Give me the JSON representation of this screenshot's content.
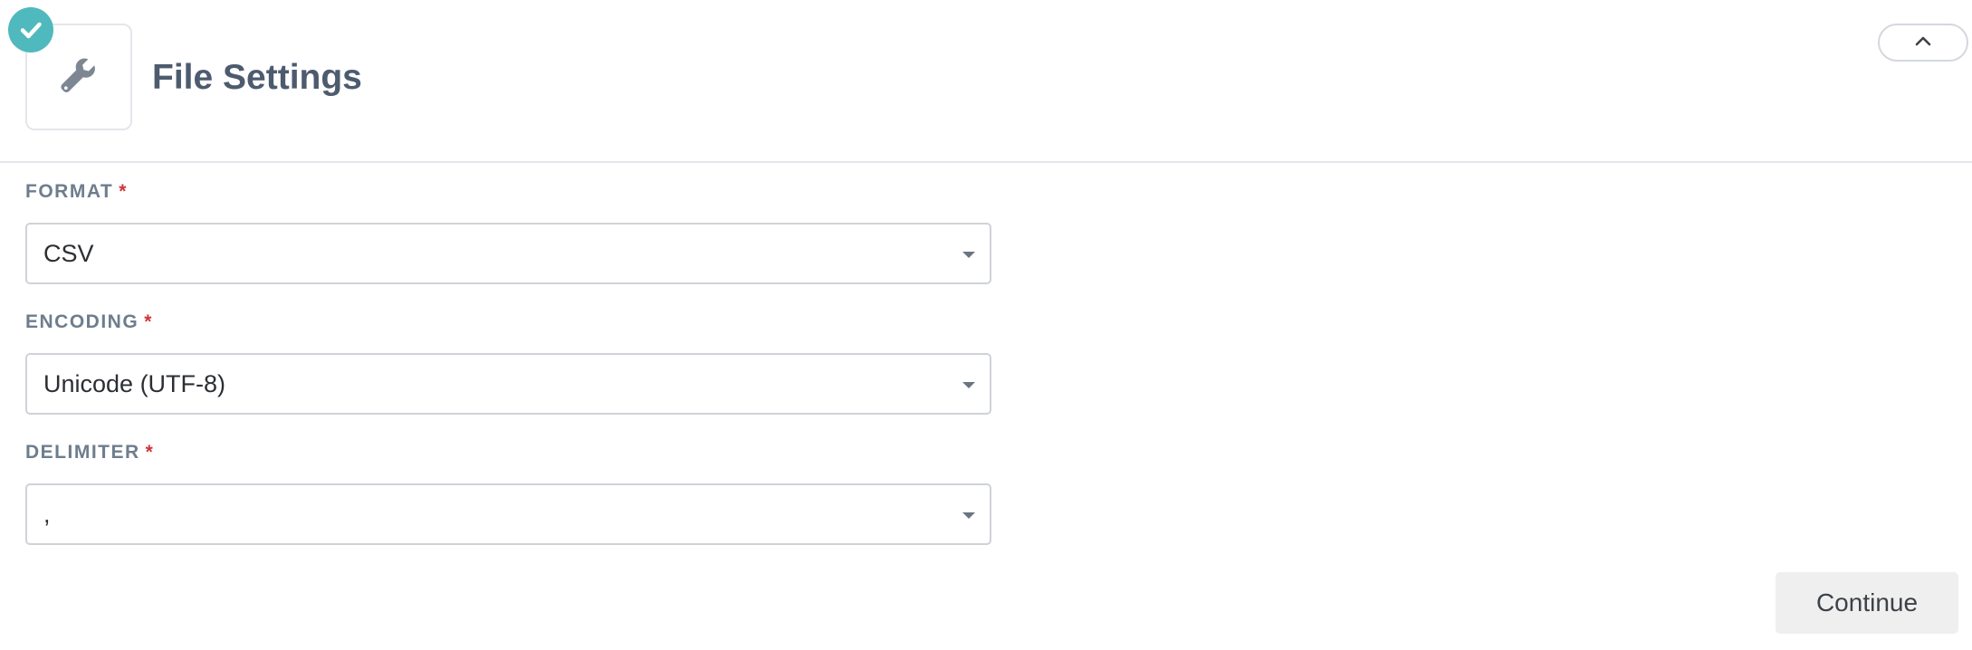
{
  "header": {
    "title": "File Settings",
    "section_icon": "wrench-icon",
    "status_icon": "checkmark-icon",
    "collapse_icon": "chevron-up-icon",
    "accent_color": "#4fb9be"
  },
  "fields": [
    {
      "label": "FORMAT",
      "required_marker": "*",
      "value": "CSV"
    },
    {
      "label": "ENCODING",
      "required_marker": "*",
      "value": "Unicode (UTF-8)"
    },
    {
      "label": "DELIMITER",
      "required_marker": "*",
      "value": ","
    }
  ],
  "actions": {
    "continue_label": "Continue"
  }
}
